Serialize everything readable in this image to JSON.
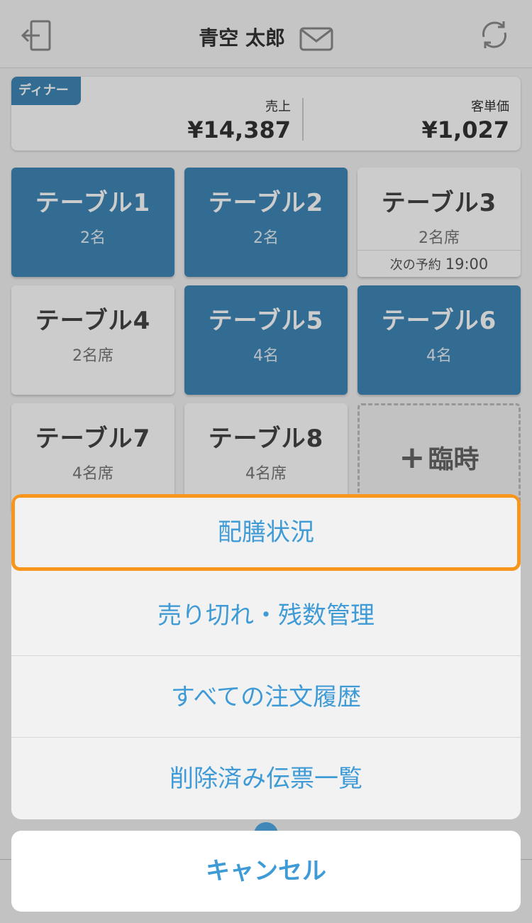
{
  "header": {
    "user_name": "青空 太郎"
  },
  "sales": {
    "meal_period": "ディナー",
    "revenue_label": "売上",
    "revenue_value": "¥14,387",
    "avg_label": "客単価",
    "avg_value": "¥1,027"
  },
  "tables": [
    {
      "name": "テーブル1",
      "seats": "2名",
      "status": "occupied"
    },
    {
      "name": "テーブル2",
      "seats": "2名",
      "status": "occupied"
    },
    {
      "name": "テーブル3",
      "seats": "2名席",
      "status": "free",
      "reservation_label": "次の予約",
      "reservation_time": "19:00"
    },
    {
      "name": "テーブル4",
      "seats": "2名席",
      "status": "free"
    },
    {
      "name": "テーブル5",
      "seats": "4名",
      "status": "occupied"
    },
    {
      "name": "テーブル6",
      "seats": "4名",
      "status": "occupied"
    },
    {
      "name": "テーブル7",
      "seats": "4名席",
      "status": "free"
    },
    {
      "name": "テーブル8",
      "seats": "4名席",
      "status": "free"
    }
  ],
  "temp_table": {
    "label": "臨時"
  },
  "action_sheet": {
    "items": [
      {
        "label": "配膳状況"
      },
      {
        "label": "売り切れ・残数管理"
      },
      {
        "label": "すべての注文履歴"
      },
      {
        "label": "削除済み伝票一覧"
      }
    ],
    "cancel_label": "キャンセル"
  },
  "colors": {
    "accent": "#3f88b8",
    "link": "#3f9bd6",
    "highlight": "#f7951d"
  }
}
